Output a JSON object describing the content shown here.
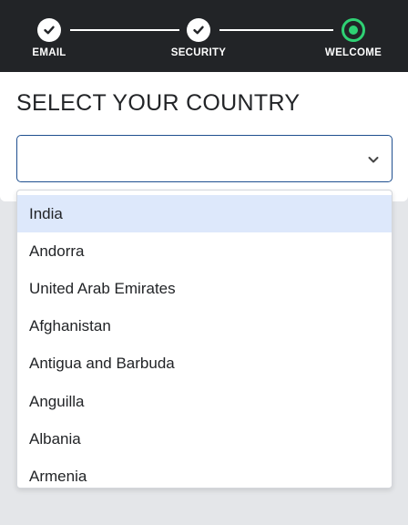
{
  "stepper": {
    "steps": [
      {
        "label": "EMAIL",
        "state": "done"
      },
      {
        "label": "SECURITY",
        "state": "done"
      },
      {
        "label": "WELCOME",
        "state": "current"
      }
    ],
    "colors": {
      "done": "#ffffff",
      "current": "#2fd174",
      "bar": "#222427"
    }
  },
  "main": {
    "title": "SELECT YOUR COUNTRY",
    "select": {
      "value": "",
      "icon": "chevron-down-icon",
      "border_color": "#1f4f8f"
    }
  },
  "dropdown": {
    "highlight_color": "#dde8fb",
    "options": [
      "India",
      "Andorra",
      "United Arab Emirates",
      "Afghanistan",
      "Antigua and Barbuda",
      "Anguilla",
      "Albania",
      "Armenia"
    ],
    "highlighted_index": 0
  }
}
